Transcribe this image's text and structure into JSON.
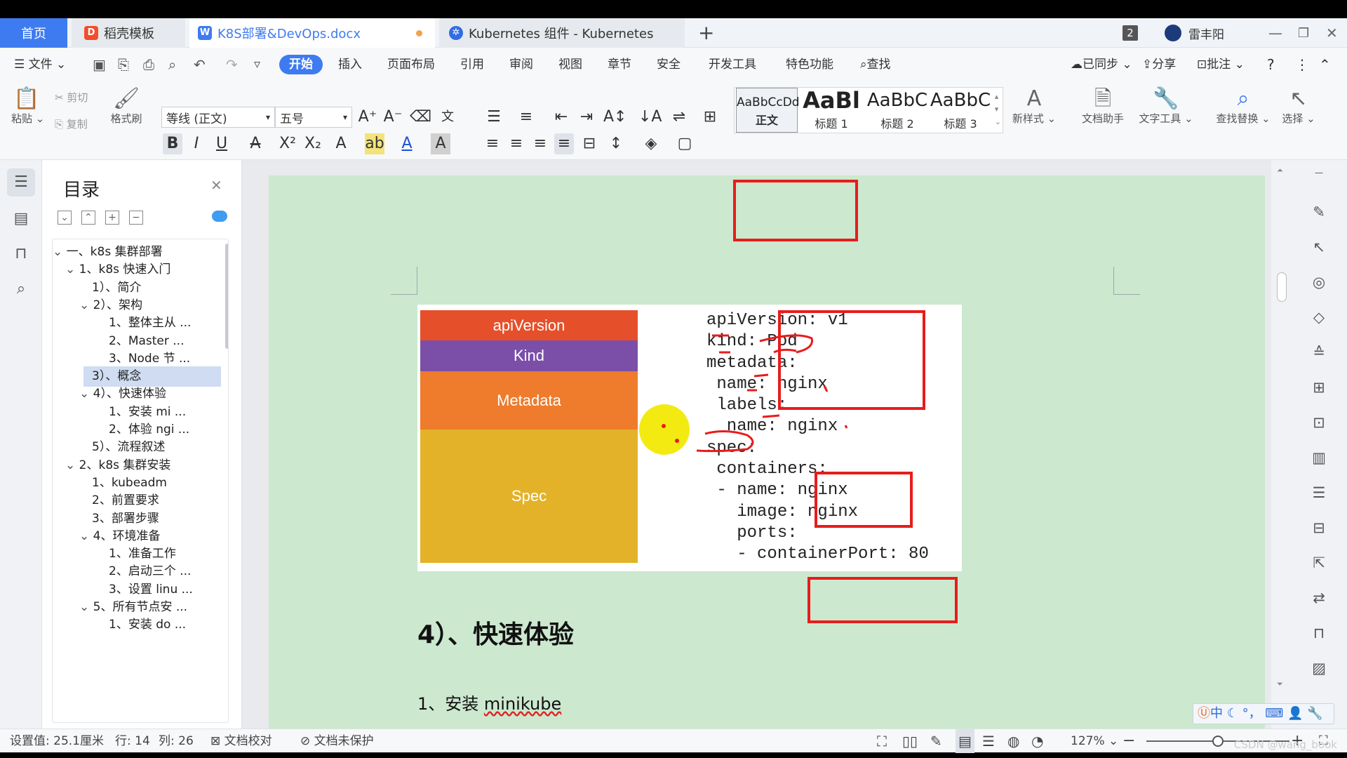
{
  "tabs": {
    "home": "首页",
    "tab1": "稻壳模板",
    "tab2": "K8S部署&DevOps.docx",
    "tab3": "Kubernetes 组件 - Kubernetes",
    "new_tab": "+"
  },
  "titlebar": {
    "badge": "2",
    "user": "雷丰阳"
  },
  "menu": {
    "file": "文件",
    "items": [
      "开始",
      "插入",
      "页面布局",
      "引用",
      "审阅",
      "视图",
      "章节",
      "安全",
      "开发工具",
      "特色功能"
    ],
    "search": "查找",
    "sync": "已同步",
    "share": "分享",
    "comment": "批注"
  },
  "ribbon": {
    "paste": "粘贴",
    "cut": "剪切",
    "copy": "复制",
    "format_painter": "格式刷",
    "font": "等线 (正文)",
    "size": "五号",
    "style_items": [
      {
        "preview": "AaBbCcDd",
        "label": "正文"
      },
      {
        "preview": "AaBl",
        "label": "标题 1"
      },
      {
        "preview": "AaBbC",
        "label": "标题 2"
      },
      {
        "preview": "AaBbC",
        "label": "标题 3"
      }
    ],
    "new_style": "新样式",
    "doc_assistant": "文档助手",
    "text_tools": "文字工具",
    "find_replace": "查找替换",
    "select": "选择"
  },
  "toc": {
    "title": "目录",
    "items": [
      {
        "label": "一、k8s 集群部署",
        "level": 0,
        "toggle": "v"
      },
      {
        "label": "1、k8s 快速入门",
        "level": 1,
        "toggle": "v"
      },
      {
        "label": "1）、简介",
        "level": 2,
        "toggle": ""
      },
      {
        "label": "2）、架构",
        "level": 2,
        "toggle": "v"
      },
      {
        "label": "1、整体主从 ...",
        "level": 3,
        "toggle": ""
      },
      {
        "label": "2、Master ...",
        "level": 3,
        "toggle": ""
      },
      {
        "label": "3、Node 节 ...",
        "level": 3,
        "toggle": ""
      },
      {
        "label": "3）、概念",
        "level": 2,
        "toggle": "",
        "selected": true
      },
      {
        "label": "4）、快速体验",
        "level": 2,
        "toggle": "v"
      },
      {
        "label": "1、安装 mi ...",
        "level": 3,
        "toggle": ""
      },
      {
        "label": "2、体验 ngi ...",
        "level": 3,
        "toggle": ""
      },
      {
        "label": "5）、流程叙述",
        "level": 2,
        "toggle": ""
      },
      {
        "label": "2、k8s 集群安装",
        "level": 1,
        "toggle": "v"
      },
      {
        "label": "1、kubeadm",
        "level": 2,
        "toggle": ""
      },
      {
        "label": "2、前置要求",
        "level": 2,
        "toggle": ""
      },
      {
        "label": "3、部署步骤",
        "level": 2,
        "toggle": ""
      },
      {
        "label": "4、环境准备",
        "level": 2,
        "toggle": "v"
      },
      {
        "label": "1、准备工作",
        "level": 3,
        "toggle": ""
      },
      {
        "label": "2、启动三个 ...",
        "level": 3,
        "toggle": ""
      },
      {
        "label": "3、设置 linu ...",
        "level": 3,
        "toggle": ""
      },
      {
        "label": "5、所有节点安 ...",
        "level": 2,
        "toggle": "v"
      },
      {
        "label": "1、安装 do ...",
        "level": 3,
        "toggle": ""
      }
    ]
  },
  "document": {
    "blocks": [
      "apiVersion",
      "Kind",
      "Metadata",
      "Spec"
    ],
    "code": "apiVersion: v1\nkind: Pod\nmetadata:\n name: nginx\n labels:\n  name: nginx\nspec:\n containers:\n - name: nginx\n   image: nginx\n   ports:\n   - containerPort: 80",
    "heading": "4）、快速体验",
    "para_prefix": "1、安装 ",
    "para_link": "minikube"
  },
  "status": {
    "setting": "设置值: 25.1厘米",
    "row": "行: 14",
    "col": "列: 26",
    "proof": "文档校对",
    "protect": "文档未保护",
    "zoom": "127%"
  },
  "ime": "中",
  "watermark": "CSDN @wang_book",
  "colors": {
    "accent": "#3f7bf0",
    "page_bg": "#cce8cf",
    "api_block": "#e5502a",
    "kind_block": "#7b4fa8",
    "meta_block": "#ef7b2c",
    "spec_block": "#e3b228",
    "annotation": "#e81c1c"
  }
}
